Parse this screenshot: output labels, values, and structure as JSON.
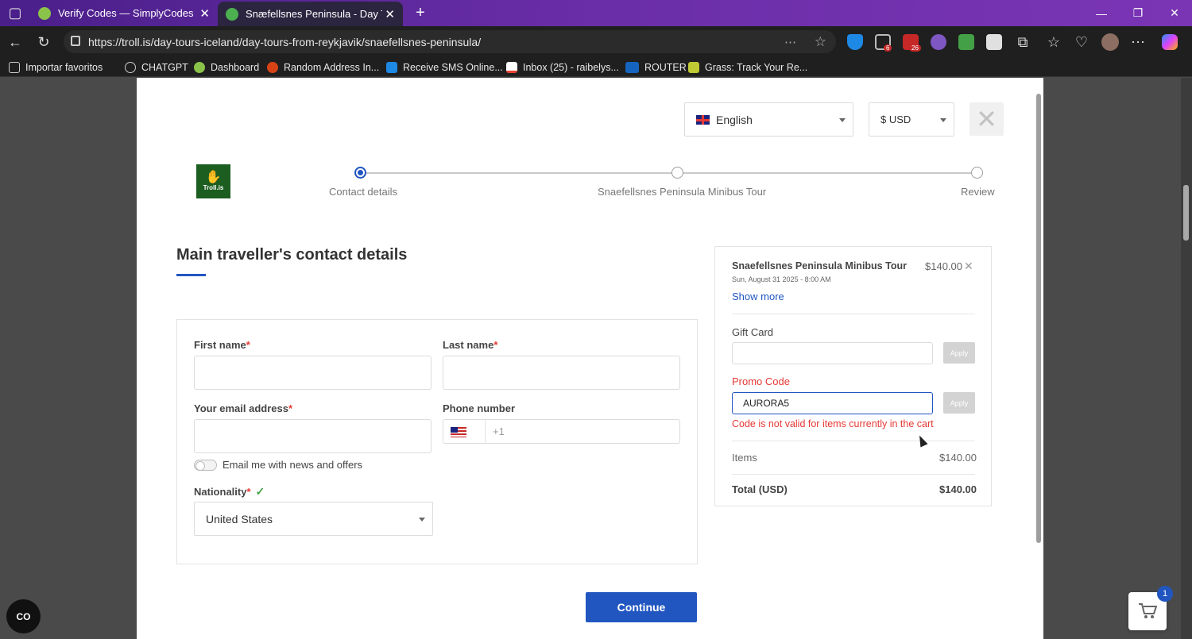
{
  "browser": {
    "tabs": [
      {
        "title": "Verify Codes — SimplyCodes",
        "active": false
      },
      {
        "title": "Snæfellsnes Peninsula - Day Tour",
        "active": true
      }
    ],
    "url": "https://troll.is/day-tours-iceland/day-tours-from-reykjavik/snaefellsnes-peninsula/",
    "extension_badges": [
      "6",
      "26"
    ],
    "bookmarks": [
      "Importar favoritos",
      "CHATGPT",
      "Dashboard",
      "Random Address In...",
      "Receive SMS Online...",
      "Inbox (25) - raibelys...",
      "ROUTER",
      "Grass: Track Your Re..."
    ]
  },
  "header": {
    "language": "English",
    "currency": "$ USD",
    "logo_text": "Troll.is"
  },
  "steps": [
    "Contact details",
    "Snaefellsnes Peninsula Minibus Tour",
    "Review"
  ],
  "form": {
    "title": "Main traveller's contact details",
    "first_name_label": "First name",
    "last_name_label": "Last name",
    "email_label": "Your email address",
    "phone_label": "Phone number",
    "phone_prefix": "+1",
    "newsletter_label": "Email me with news and offers",
    "nationality_label": "Nationality",
    "nationality_value": "United States",
    "required_mark": "*",
    "check_mark": "✓"
  },
  "continue_label": "Continue",
  "summary": {
    "tour_name": "Snaefellsnes Peninsula Minibus Tour",
    "tour_price": "$140.00",
    "tour_date": "Sun, August 31 2025 - 8:00 AM",
    "show_more": "Show more",
    "gift_card_label": "Gift Card",
    "apply_label": "Apply",
    "promo_label": "Promo Code",
    "promo_value": "AURORA5",
    "promo_error": "Code is not valid for items currently in the cart",
    "items_label": "Items",
    "items_value": "$140.00",
    "total_label": "Total (USD)",
    "total_value": "$140.00"
  },
  "cart_count": "1",
  "float_button_label": "CO",
  "colors": {
    "accent": "#2156c1",
    "error": "#e53935",
    "success": "#43a047"
  }
}
